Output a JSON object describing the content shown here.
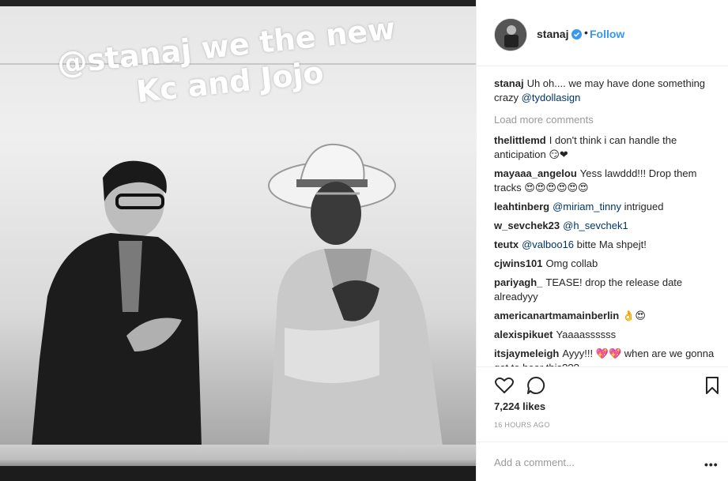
{
  "photo": {
    "story_text": "@stanaj we the new Kc and Jojo",
    "alt": "photo"
  },
  "header": {
    "username": "stanaj",
    "separator": "•",
    "follow_label": "Follow",
    "verified_icon": "verified-badge-icon",
    "accent_color": "#3897f0"
  },
  "caption": {
    "username": "stanaj",
    "text": "Uh oh.... we may have done something crazy ",
    "mention": "@tydollasign"
  },
  "load_more_label": "Load more comments",
  "comments": [
    {
      "user": "thelittlemd",
      "text": "I don't think i can handle the anticipation 😏❤"
    },
    {
      "user": "mayaaa_angelou",
      "text": "Yess lawddd!!! Drop them tracks 😍😍😍😍😍😍"
    },
    {
      "user": "leahtinberg",
      "mention": "@miriam_tinny",
      "text": " intrigued"
    },
    {
      "user": "w_sevchek23",
      "mention": "@h_sevchek1",
      "text": ""
    },
    {
      "user": "teutx",
      "mention": "@valboo16",
      "text": " bitte Ma shpejt!"
    },
    {
      "user": "cjwins101",
      "text": "Omg collab"
    },
    {
      "user": "pariyagh_",
      "text": "TEASE! drop the release date alreadyyy"
    },
    {
      "user": "americanartmamainberlin",
      "text": "👌😍"
    },
    {
      "user": "alexispikuet",
      "text": "Yaaaassssss"
    },
    {
      "user": "itsjaymeleigh",
      "text": "Ayyy!!! 💖💖 when are we gonna get to hear this???"
    }
  ],
  "actions": {
    "like_icon": "heart-icon",
    "comment_icon": "comment-icon",
    "save_icon": "bookmark-icon",
    "likes": "7,224 likes",
    "time": "16 HOURS AGO"
  },
  "add_comment": {
    "placeholder": "Add a comment...",
    "more_label": "•••"
  }
}
